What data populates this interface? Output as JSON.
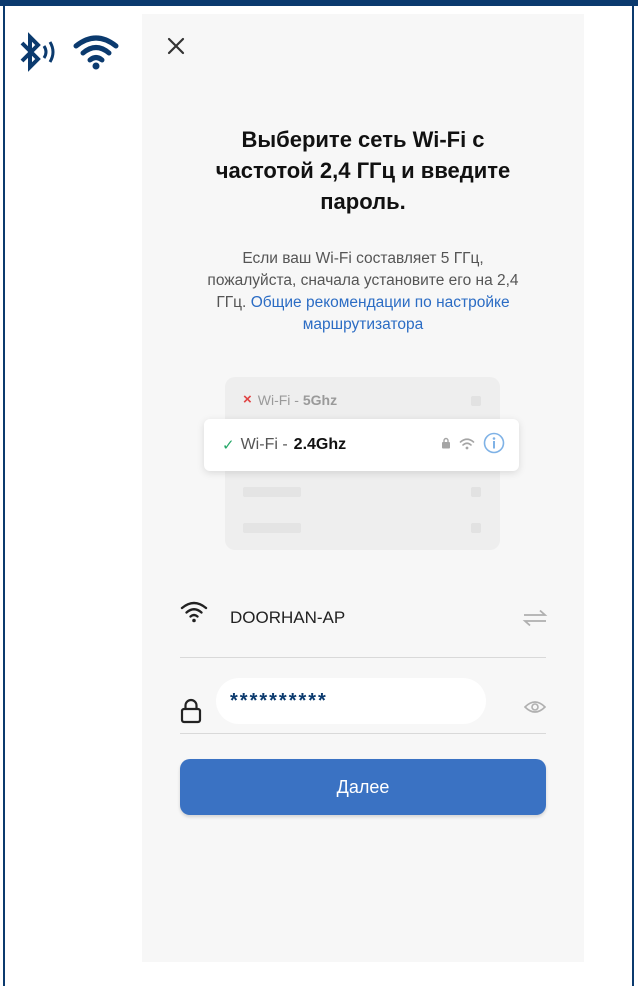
{
  "title_lines": [
    "Выберите сеть Wi-Fi с",
    "частотой 2,4 ГГц и введите",
    "пароль."
  ],
  "description": {
    "line1": "Если ваш Wi-Fi составляет 5 ГГц,",
    "line2": "пожалуйста, сначала установите его на 2,4",
    "line3_prefix": "ГГц.",
    "link_part1": "Общие рекомендации по настройке",
    "link_part2": "маршрутизатора"
  },
  "illustration": {
    "bad_mark": "×",
    "bad_prefix": "Wi-Fi - ",
    "bad_band": "5Ghz",
    "good_mark": "✓",
    "good_prefix": "Wi-Fi - ",
    "good_band": "2.4Ghz"
  },
  "ssid": {
    "value": "DOORHAN-AP"
  },
  "password": {
    "value": "**********"
  },
  "next_label": "Далее",
  "colors": {
    "accent": "#3a72c3",
    "link": "#2b6cc4",
    "frame": "#0b3a6e",
    "ok": "#27a869",
    "bad": "#e04444"
  }
}
